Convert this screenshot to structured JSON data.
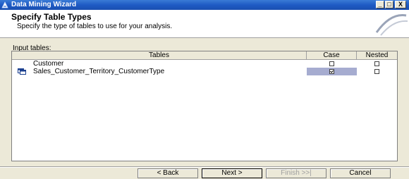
{
  "window": {
    "title": "Data Mining Wizard",
    "minimize_label": "_",
    "maximize_label": "□",
    "close_label": "X"
  },
  "header": {
    "title": "Specify Table Types",
    "subtitle": "Specify the type of tables to use for your analysis."
  },
  "input_tables": {
    "label_accel": "I",
    "label_rest": "nput tables:",
    "columns": [
      "Tables",
      "Case",
      "Nested"
    ],
    "rows": [
      {
        "name": "Customer",
        "case": false,
        "nested": false,
        "icon": "none"
      },
      {
        "name": "Sales_Customer_Territory_CustomerType",
        "case": true,
        "nested": false,
        "icon": "table-icon"
      }
    ]
  },
  "buttons": {
    "back": "< Back",
    "next": "Next >",
    "finish": "Finish >>|",
    "cancel": "Cancel"
  }
}
